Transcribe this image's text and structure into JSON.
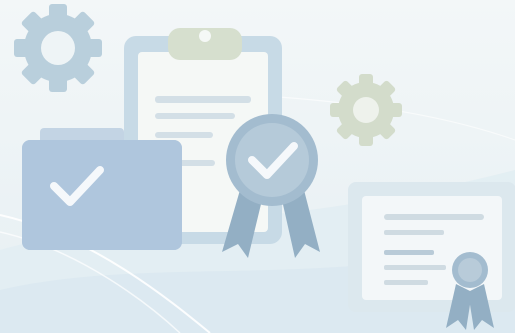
{
  "illustration": {
    "elements": [
      "gear-icon",
      "clipboard-document",
      "folder-with-checkmark",
      "award-ribbon-badge",
      "certificate-card"
    ]
  },
  "palette": {
    "background": "#eef4f6",
    "gear_blue": "#b9cfdc",
    "gear_green": "#d3dccb",
    "clipboard_frame": "#c7dae6",
    "clipboard_paper": "#f5f8f6",
    "folder_blue": "#a9c1da",
    "badge_blue": "#93afc4",
    "certificate_frame": "#dce8ee",
    "line_gray": "#cfdbe2"
  }
}
